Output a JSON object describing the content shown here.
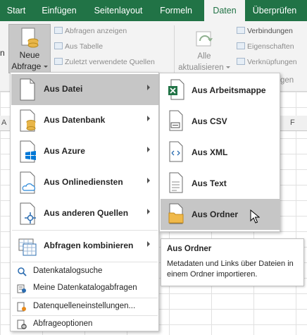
{
  "ribbon": {
    "tabs": [
      "Start",
      "Einfügen",
      "Seitenlayout",
      "Formeln",
      "Daten",
      "Überprüfen"
    ],
    "active_tab": "Daten",
    "left_stub_label": "n",
    "new_query_label_1": "Neue",
    "new_query_label_2": "Abfrage",
    "cmd_show_queries": "Abfragen anzeigen",
    "cmd_from_table": "Aus Tabelle",
    "cmd_recent_sources": "Zuletzt verwendete Quellen",
    "refresh_label_1": "Alle",
    "refresh_label_2": "aktualisieren",
    "cmd_connections": "Verbindungen",
    "cmd_properties": "Eigenschaften",
    "cmd_edit_links": "Verknüpfungen",
    "group_label_partial": "gen",
    "accent_color": "#217346"
  },
  "menu": {
    "items": [
      {
        "label": "Aus Datei",
        "icon": "file-icon",
        "highlighted": true
      },
      {
        "label": "Aus Datenbank",
        "icon": "database-icon",
        "highlighted": false
      },
      {
        "label": "Aus Azure",
        "icon": "azure-windows-icon",
        "highlighted": false
      },
      {
        "label": "Aus Onlinediensten",
        "icon": "cloud-file-icon",
        "highlighted": false
      },
      {
        "label": "Aus anderen Quellen",
        "icon": "other-sources-icon",
        "highlighted": false
      },
      {
        "label": "Abfragen kombinieren",
        "icon": "combine-queries-icon",
        "highlighted": false
      }
    ],
    "small_items": [
      {
        "label": "Datenkatalogsuche",
        "icon": "catalog-search-icon"
      },
      {
        "label": "Meine Datenkatalogabfragen",
        "icon": "catalog-queries-icon"
      },
      {
        "label": "Datenquelleneinstellungen...",
        "icon": "source-settings-icon"
      },
      {
        "label": "Abfrageoptionen",
        "icon": "query-options-icon"
      }
    ]
  },
  "submenu": {
    "items": [
      {
        "label": "Aus Arbeitsmappe",
        "icon": "excel-workbook-icon",
        "highlighted": false
      },
      {
        "label": "Aus CSV",
        "icon": "csv-file-icon",
        "highlighted": false
      },
      {
        "label": "Aus XML",
        "icon": "xml-file-icon",
        "highlighted": false
      },
      {
        "label": "Aus Text",
        "icon": "text-file-icon",
        "highlighted": false
      },
      {
        "label": "Aus Ordner",
        "icon": "folder-icon",
        "highlighted": true
      }
    ]
  },
  "tooltip": {
    "title": "Aus Ordner",
    "description": "Metadaten und Links über Dateien in einem Ordner importieren."
  },
  "sheet": {
    "col_hint_left": "A",
    "col_hint_right": "F"
  }
}
